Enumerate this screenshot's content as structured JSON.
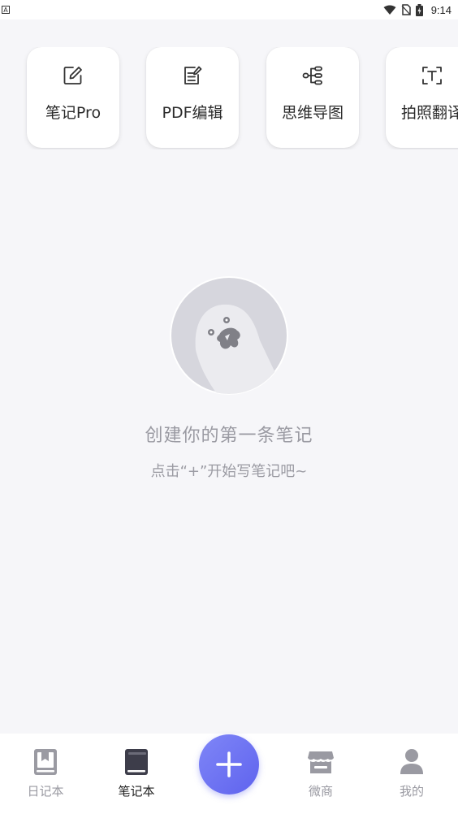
{
  "status_bar": {
    "time": "9:14",
    "icons": [
      "notification-a-icon",
      "wifi-icon",
      "sim-no-signal-icon",
      "battery-charging-icon"
    ]
  },
  "shortcuts": [
    {
      "label": "笔记Pro",
      "icon": "edit-pencil-icon"
    },
    {
      "label": "PDF编辑",
      "icon": "pdf-edit-icon"
    },
    {
      "label": "思维导图",
      "icon": "mind-map-icon"
    },
    {
      "label": "拍照翻译",
      "icon": "scan-text-icon"
    }
  ],
  "empty_state": {
    "title": "创建你的第一条笔记",
    "subtitle": "点击“+”开始写笔记吧~"
  },
  "bottom_nav": {
    "items": [
      {
        "label": "日记本",
        "icon": "diary-book-icon",
        "active": false
      },
      {
        "label": "笔记本",
        "icon": "notebook-icon",
        "active": true
      },
      {
        "label": "微商",
        "icon": "store-icon",
        "active": false
      },
      {
        "label": "我的",
        "icon": "person-icon",
        "active": false
      }
    ],
    "fab_icon": "plus-icon"
  },
  "colors": {
    "background": "#f6f6f9",
    "accent": "#6a6ff2",
    "inactive": "#9a9aa2",
    "active_icon": "#3d3d4a"
  }
}
